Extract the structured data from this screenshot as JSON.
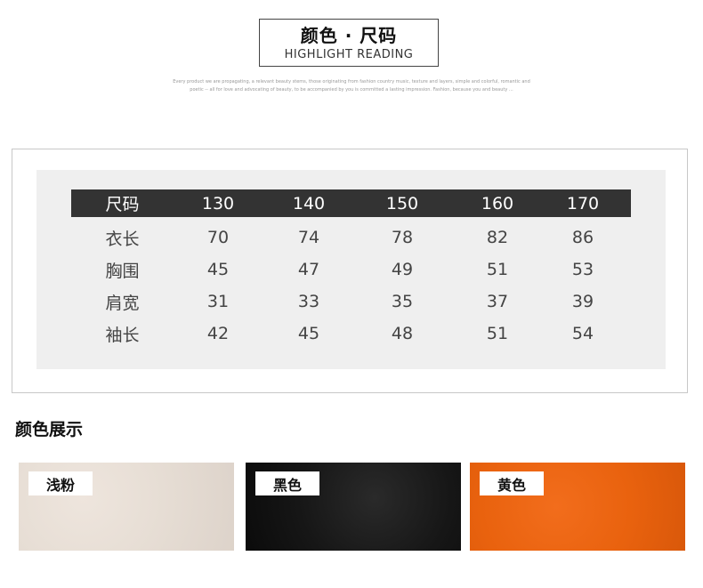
{
  "title": {
    "cn": "颜色 · 尺码",
    "en": "HIGHLIGHT READING",
    "tagline_line1": "Every product we are propagating, a relevant beauty stems, those originating from fashion country music, texture and layers, simple and colorful, romantic and",
    "tagline_line2": "poetic -- all for love and advocating of beauty, to be accompanied by you is committed a lasting impression. Fashion, because you and beauty ..."
  },
  "size_table": {
    "header": [
      "尺码",
      "130",
      "140",
      "150",
      "160",
      "170"
    ],
    "rows": [
      [
        "衣长",
        "70",
        "74",
        "78",
        "82",
        "86"
      ],
      [
        "胸围",
        "45",
        "47",
        "49",
        "51",
        "53"
      ],
      [
        "肩宽",
        "31",
        "33",
        "35",
        "37",
        "39"
      ],
      [
        "袖长",
        "42",
        "45",
        "48",
        "51",
        "54"
      ]
    ]
  },
  "colors_section": {
    "heading": "颜色展示",
    "swatches": [
      {
        "label": "浅粉",
        "color": "#e7ded5"
      },
      {
        "label": "黑色",
        "color": "#161616"
      },
      {
        "label": "黄色",
        "color": "#e9620e"
      }
    ]
  }
}
